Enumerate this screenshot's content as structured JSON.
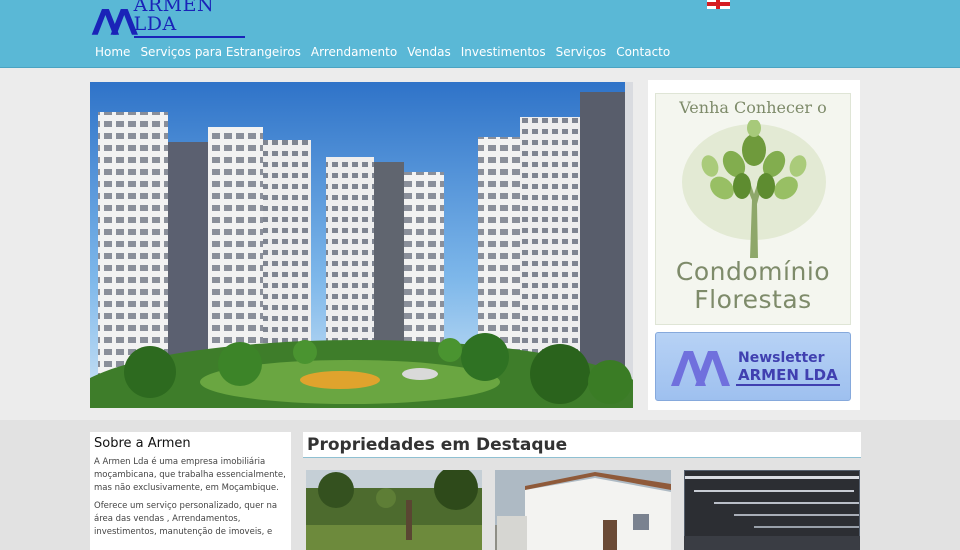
{
  "header": {
    "logo_text": "ARMEN LDA",
    "language_flag": "england-flag-icon"
  },
  "nav": {
    "items": [
      {
        "label": "Home"
      },
      {
        "label": "Serviços para Estrangeiros"
      },
      {
        "label": "Arrendamento"
      },
      {
        "label": "Vendas"
      },
      {
        "label": "Investimentos"
      },
      {
        "label": "Serviços"
      },
      {
        "label": "Contacto"
      }
    ]
  },
  "promo": {
    "condo_top": "Venha Conhecer o",
    "condo_title_1": "Condomínio",
    "condo_title_2": "Florestas",
    "newsletter_line1": "Newsletter",
    "newsletter_line2": "ARMEN LDA"
  },
  "about": {
    "title": "Sobre a Armen",
    "p1": "A Armen Lda é uma empresa imobiliária moçambicana, que trabalha essencialmente, mas não exclusivamente, em Moçambique.",
    "p2": "Oferece um serviço personalizado, quer na área das vendas , Arrendamentos, investimentos, manutenção de imoveis, e"
  },
  "featured": {
    "title": "Propriedades em Destaque"
  },
  "colors": {
    "header": "#5ab8d6",
    "logo": "#1a23b8",
    "nav_text": "#ffffff",
    "background": "#ececec",
    "accent_line": "#8fc0d2"
  }
}
